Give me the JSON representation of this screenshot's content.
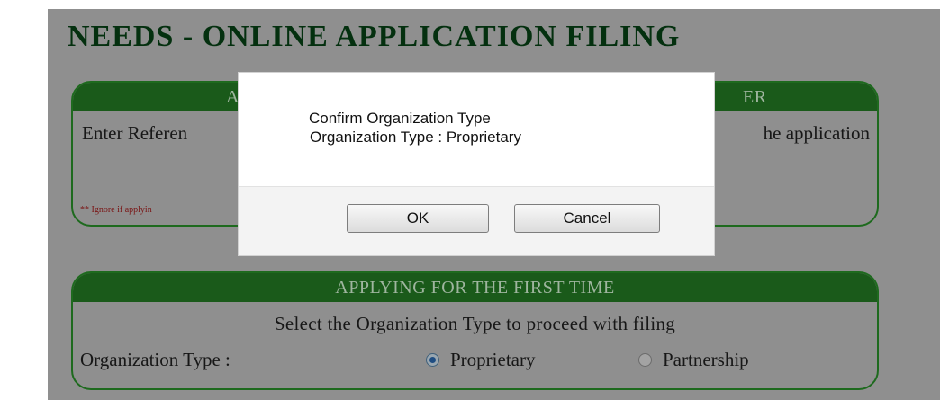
{
  "page": {
    "title": "NEEDS - ONLINE APPLICATION FILING"
  },
  "reference_panel": {
    "header_left": "AL",
    "header_right": "ER",
    "text_left": "Enter Referen",
    "text_right": "he application",
    "note": "** Ignore if applyin"
  },
  "first_time_panel": {
    "header": "APPLYING FOR THE FIRST TIME",
    "subtitle": "Select the Organization Type to proceed with filing",
    "org_label": "Organization Type :",
    "options": [
      {
        "label": "Proprietary",
        "checked": true
      },
      {
        "label": "Partnership",
        "checked": false
      }
    ]
  },
  "dialog": {
    "line1": "Confirm Organization Type",
    "line2": "Organization Type : Proprietary",
    "ok_label": "OK",
    "cancel_label": "Cancel"
  },
  "colors": {
    "panel_header": "#1a5a1a",
    "overlay": "#8f8f8f",
    "title": "#04300f"
  }
}
